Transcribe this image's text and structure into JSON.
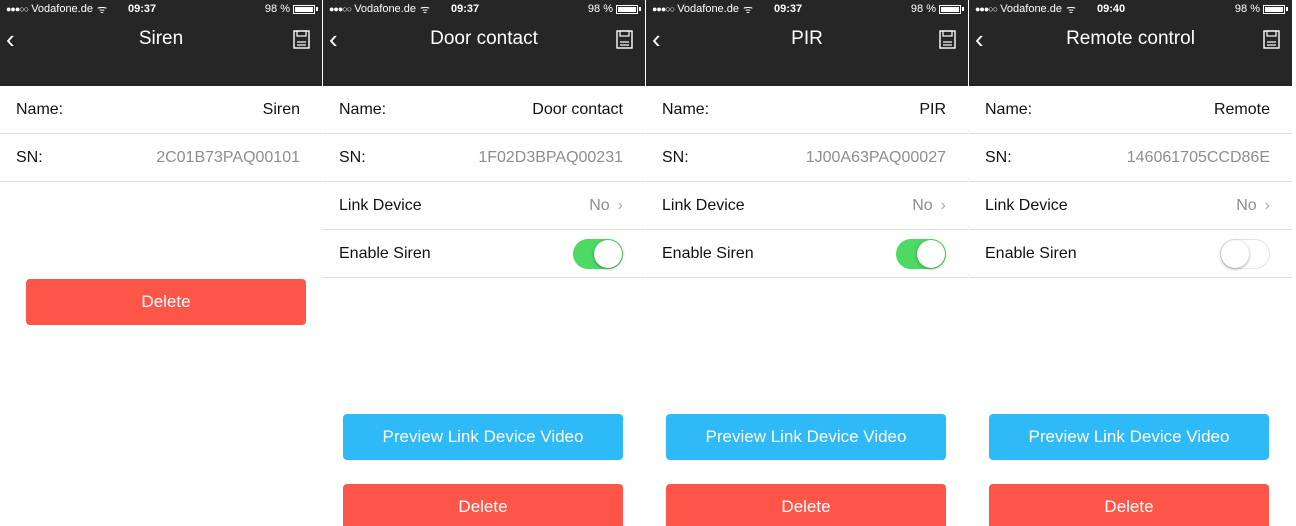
{
  "colors": {
    "topbar": "#262626",
    "delete": "#fe5549",
    "preview": "#2dbaf6",
    "toggle_on": "#4cd964"
  },
  "labels": {
    "name": "Name:",
    "sn": "SN:",
    "link_device": "Link Device",
    "enable_siren": "Enable Siren",
    "preview": "Preview Link Device Video",
    "delete": "Delete"
  },
  "screens": [
    {
      "status": {
        "carrier": "Vodafone.de",
        "time": "09:37",
        "battery": "98 %"
      },
      "title": "Siren",
      "name": "Siren",
      "sn": "2C01B73PAQ00101"
    },
    {
      "status": {
        "carrier": "Vodafone.de",
        "time": "09:37",
        "battery": "98 %"
      },
      "title": "Door contact",
      "name": "Door contact",
      "sn": "1F02D3BPAQ00231",
      "link_device": "No",
      "enable_siren": true
    },
    {
      "status": {
        "carrier": "Vodafone.de",
        "time": "09:37",
        "battery": "98 %"
      },
      "title": "PIR",
      "name": "PIR",
      "sn": "1J00A63PAQ00027",
      "link_device": "No",
      "enable_siren": true
    },
    {
      "status": {
        "carrier": "Vodafone.de",
        "time": "09:40",
        "battery": "98 %"
      },
      "title": "Remote control",
      "name": "Remote",
      "sn": "146061705CCD86E",
      "link_device": "No",
      "enable_siren": false
    }
  ]
}
